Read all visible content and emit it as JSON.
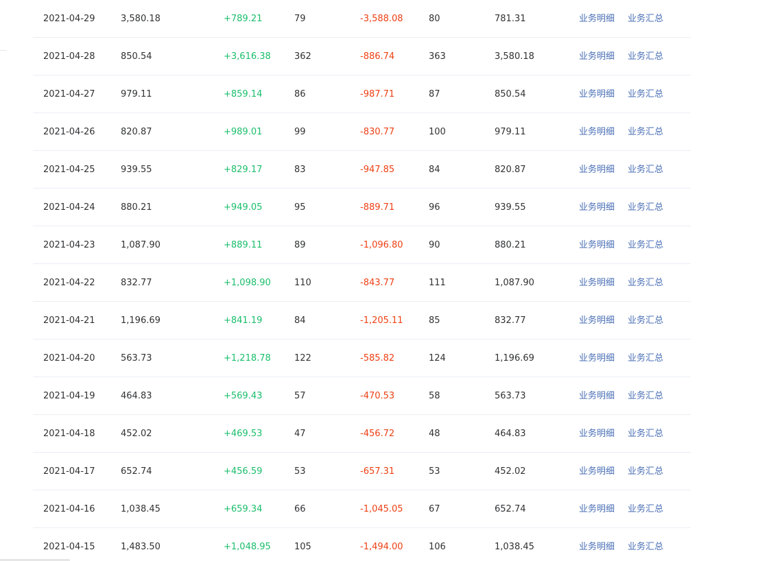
{
  "table": {
    "link_detail": "业务明细",
    "link_summary": "业务汇总",
    "rows": [
      {
        "date": "2021-04-29",
        "start_balance": "3,580.18",
        "income": "+789.21",
        "income_count": "79",
        "expense": "-3,588.08",
        "expense_count": "80",
        "end_balance": "781.31"
      },
      {
        "date": "2021-04-28",
        "start_balance": "850.54",
        "income": "+3,616.38",
        "income_count": "362",
        "expense": "-886.74",
        "expense_count": "363",
        "end_balance": "3,580.18"
      },
      {
        "date": "2021-04-27",
        "start_balance": "979.11",
        "income": "+859.14",
        "income_count": "86",
        "expense": "-987.71",
        "expense_count": "87",
        "end_balance": "850.54"
      },
      {
        "date": "2021-04-26",
        "start_balance": "820.87",
        "income": "+989.01",
        "income_count": "99",
        "expense": "-830.77",
        "expense_count": "100",
        "end_balance": "979.11"
      },
      {
        "date": "2021-04-25",
        "start_balance": "939.55",
        "income": "+829.17",
        "income_count": "83",
        "expense": "-947.85",
        "expense_count": "84",
        "end_balance": "820.87"
      },
      {
        "date": "2021-04-24",
        "start_balance": "880.21",
        "income": "+949.05",
        "income_count": "95",
        "expense": "-889.71",
        "expense_count": "96",
        "end_balance": "939.55"
      },
      {
        "date": "2021-04-23",
        "start_balance": "1,087.90",
        "income": "+889.11",
        "income_count": "89",
        "expense": "-1,096.80",
        "expense_count": "90",
        "end_balance": "880.21"
      },
      {
        "date": "2021-04-22",
        "start_balance": "832.77",
        "income": "+1,098.90",
        "income_count": "110",
        "expense": "-843.77",
        "expense_count": "111",
        "end_balance": "1,087.90"
      },
      {
        "date": "2021-04-21",
        "start_balance": "1,196.69",
        "income": "+841.19",
        "income_count": "84",
        "expense": "-1,205.11",
        "expense_count": "85",
        "end_balance": "832.77"
      },
      {
        "date": "2021-04-20",
        "start_balance": "563.73",
        "income": "+1,218.78",
        "income_count": "122",
        "expense": "-585.82",
        "expense_count": "124",
        "end_balance": "1,196.69"
      },
      {
        "date": "2021-04-19",
        "start_balance": "464.83",
        "income": "+569.43",
        "income_count": "57",
        "expense": "-470.53",
        "expense_count": "58",
        "end_balance": "563.73"
      },
      {
        "date": "2021-04-18",
        "start_balance": "452.02",
        "income": "+469.53",
        "income_count": "47",
        "expense": "-456.72",
        "expense_count": "48",
        "end_balance": "464.83"
      },
      {
        "date": "2021-04-17",
        "start_balance": "652.74",
        "income": "+456.59",
        "income_count": "53",
        "expense": "-657.31",
        "expense_count": "53",
        "end_balance": "452.02"
      },
      {
        "date": "2021-04-16",
        "start_balance": "1,038.45",
        "income": "+659.34",
        "income_count": "66",
        "expense": "-1,045.05",
        "expense_count": "67",
        "end_balance": "652.74"
      },
      {
        "date": "2021-04-15",
        "start_balance": "1,483.50",
        "income": "+1,048.95",
        "income_count": "105",
        "expense": "-1,494.00",
        "expense_count": "106",
        "end_balance": "1,038.45"
      }
    ]
  },
  "colors": {
    "income": "#19be6b",
    "expense": "#ed4014",
    "link": "#4a6fb5",
    "text": "#303133",
    "row_border": "#ebeef5"
  }
}
